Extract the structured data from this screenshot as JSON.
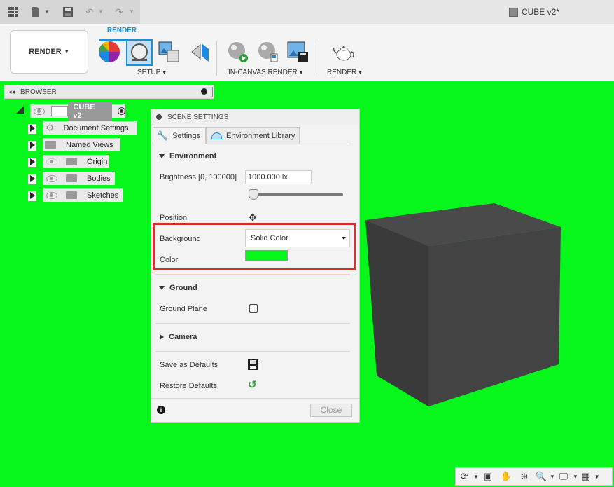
{
  "window": {
    "document_title": "CUBE v2*"
  },
  "quick_access": {
    "icons": [
      "grid-icon",
      "file-icon",
      "save-icon",
      "undo-icon",
      "redo-icon"
    ]
  },
  "ribbon": {
    "workspace_label": "RENDER",
    "active_tab": "RENDER",
    "groups": {
      "setup": "SETUP",
      "in_canvas_render": "IN-CANVAS RENDER",
      "render": "RENDER"
    }
  },
  "browser": {
    "title": "BROWSER",
    "root": {
      "label": "CUBE v2"
    },
    "items": [
      {
        "label": "Document Settings"
      },
      {
        "label": "Named Views"
      },
      {
        "label": "Origin"
      },
      {
        "label": "Bodies"
      },
      {
        "label": "Sketches"
      }
    ]
  },
  "scene_settings": {
    "title": "SCENE SETTINGS",
    "tabs": [
      "Settings",
      "Environment Library"
    ],
    "environment": {
      "heading": "Environment",
      "brightness_label": "Brightness [0, 100000]",
      "brightness_value": "1000.000 lx",
      "brightness_fraction": 0.01,
      "position_label": "Position",
      "background_label": "Background",
      "background_value": "Solid Color",
      "color_label": "Color",
      "color_value": "#07f61c"
    },
    "ground": {
      "heading": "Ground",
      "ground_plane_label": "Ground Plane",
      "ground_plane_checked": false
    },
    "camera": {
      "heading": "Camera"
    },
    "save_defaults_label": "Save as Defaults",
    "restore_defaults_label": "Restore Defaults",
    "close_label": "Close"
  },
  "canvas": {
    "background_color": "#07f61c",
    "object": "cube"
  },
  "accent_color": "#1e8fd6",
  "highlight_color": "#e02a2a"
}
